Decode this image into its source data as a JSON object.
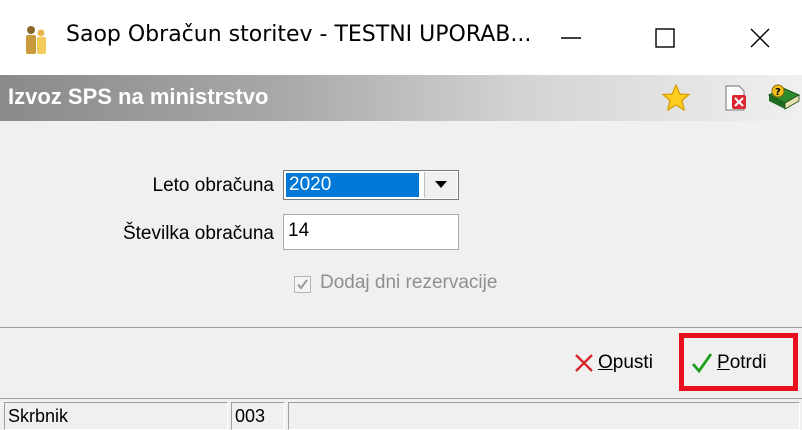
{
  "window": {
    "title": "Saop Obračun storitev - TESTNI UPORAB...",
    "app_icon": "people-icon",
    "minimize_icon": "minimize-icon",
    "maximize_icon": "maximize-icon",
    "close_icon": "close-icon"
  },
  "header": {
    "title": "Izvoz SPS na ministrstvo",
    "icons": [
      "star-icon",
      "close-document-icon",
      "help-book-icon"
    ]
  },
  "form": {
    "year_label": "Leto obračuna",
    "year_value": "2020",
    "number_label": "Številka obračuna",
    "number_value": "14",
    "reservation_label": "Dodaj dni rezervacije",
    "reservation_checked": true,
    "reservation_disabled": true
  },
  "footer": {
    "cancel_label_accel": "O",
    "cancel_label_rest": "pusti",
    "confirm_label_accel": "P",
    "confirm_label_rest": "otrdi",
    "cancel_icon_color": "#d9262f",
    "confirm_icon_color": "#1e9e1e",
    "highlight_color": "#e8101f"
  },
  "status": {
    "user": "Skrbnik",
    "code": "003",
    "message": ""
  }
}
